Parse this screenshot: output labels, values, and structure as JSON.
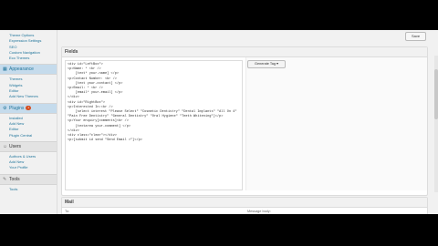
{
  "sidebar": {
    "top_links": [
      "Theme Options",
      "Expression Settings",
      "SEO",
      "Custom Navigation",
      "Eco Themes"
    ],
    "appearance": {
      "label": "Appearance",
      "items": [
        "Themes",
        "Widgets",
        "Editor",
        "Add New Themes"
      ]
    },
    "plugins": {
      "label": "Plugins",
      "badge": "1",
      "items": [
        "Installed",
        "Add New",
        "Editor",
        "Plugin Central"
      ]
    },
    "users": {
      "label": "Users",
      "items": [
        "Authors & Users",
        "Add New",
        "Your Profile"
      ]
    },
    "tools": {
      "label": "Tools",
      "items": [
        "Tools"
      ]
    }
  },
  "toolbar": {
    "save_label": "Save"
  },
  "fields": {
    "title": "Fields",
    "code_lines": [
      "<div id=\"LeftBox\">",
      "<p>Name: * <br />",
      "    [text* your-name] </p>",
      "<p>Contact Number: <br />",
      "    [text your-contact] </p>",
      "<p>Email: * <br />",
      "    [email* your-email] </p>",
      "</div>",
      "<div id=\"RightBox\">",
      "<p>Interested In:<br />",
      "    [select interest \"Please Select\" \"Cosmetic Dentistry\" \"Dental Implants\" \"All On 4\" \"Pain Free Dentistry\" \"General Dentistry\" \"Oral Hygiene\" \"Teeth Whitening\"]</p>",
      "<p>Your enquiry[comments]<br />",
      "    [textarea your-comment] </p>",
      "</div>",
      "<div class=\"clear\"></div>",
      "<p>[submit id send \"Send Email >\"]</p>"
    ],
    "generate_tag_label": "Generate Tag ▾"
  },
  "mail": {
    "title": "Mail",
    "col_to": "To:",
    "col_message": "Message body:"
  }
}
